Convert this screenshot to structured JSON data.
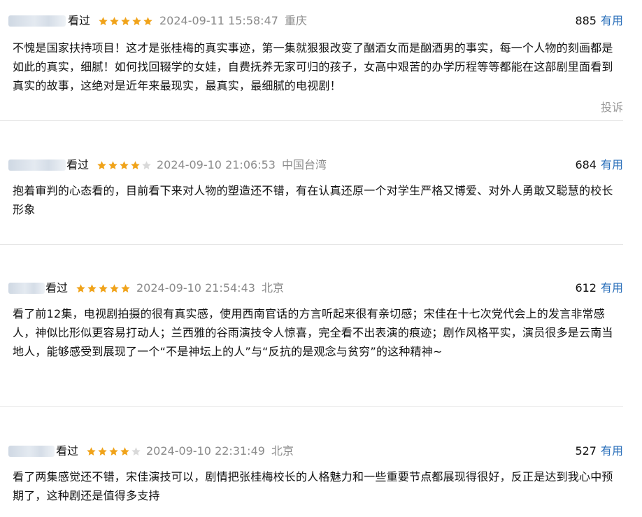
{
  "colors": {
    "star": "#f0a31a",
    "star_empty": "#d9d9d9",
    "link": "#2a6fba",
    "meta": "#8a8a8a"
  },
  "comments": [
    {
      "seen": "看过",
      "rating": 5,
      "date": "2024-09-11 15:58:47",
      "location": "重庆",
      "votes": "885",
      "useful": "有用",
      "text": "不愧是国家扶持项目！这才是张桂梅的真实事迹，第一集就狠狠改变了酗酒女而是酗酒男的事实，每一个人物的刻画都是如此的真实，细腻！如何找回辍学的女娃，自费抚养无家可归的孩子，女高中艰苦的办学历程等等都能在这部剧里面看到真实的故事，这绝对是近年来最现实，最真实，最细腻的电视剧！",
      "report": "投诉"
    },
    {
      "seen": "看过",
      "rating": 4,
      "date": "2024-09-10 21:06:53",
      "location": "中国台湾",
      "votes": "684",
      "useful": "有用",
      "text": "抱着审判的心态看的，目前看下来对人物的塑造还不错，有在认真还原一个对学生严格又博爱、对外人勇敢又聪慧的校长形象"
    },
    {
      "seen": "看过",
      "rating": 5,
      "date": "2024-09-10 21:54:43",
      "location": "北京",
      "votes": "612",
      "useful": "有用",
      "text": "看了前12集，电视剧拍摄的很有真实感，使用西南官话的方言听起来很有亲切感；宋佳在十七次党代会上的发言非常感人，神似比形似更容易打动人；兰西雅的谷雨演技令人惊喜，完全看不出表演的痕迹；剧作风格平实，演员很多是云南当地人，能够感受到展现了一个“不是神坛上的人”与“反抗的是观念与贫穷”的这种精神~"
    },
    {
      "seen": "看过",
      "rating": 4,
      "date": "2024-09-10 22:31:49",
      "location": "北京",
      "votes": "527",
      "useful": "有用",
      "text": "看了两集感觉还不错，宋佳演技可以，剧情把张桂梅校长的人格魅力和一些重要节点都展现得很好，反正是达到我心中预期了，这种剧还是值得多支持"
    }
  ]
}
